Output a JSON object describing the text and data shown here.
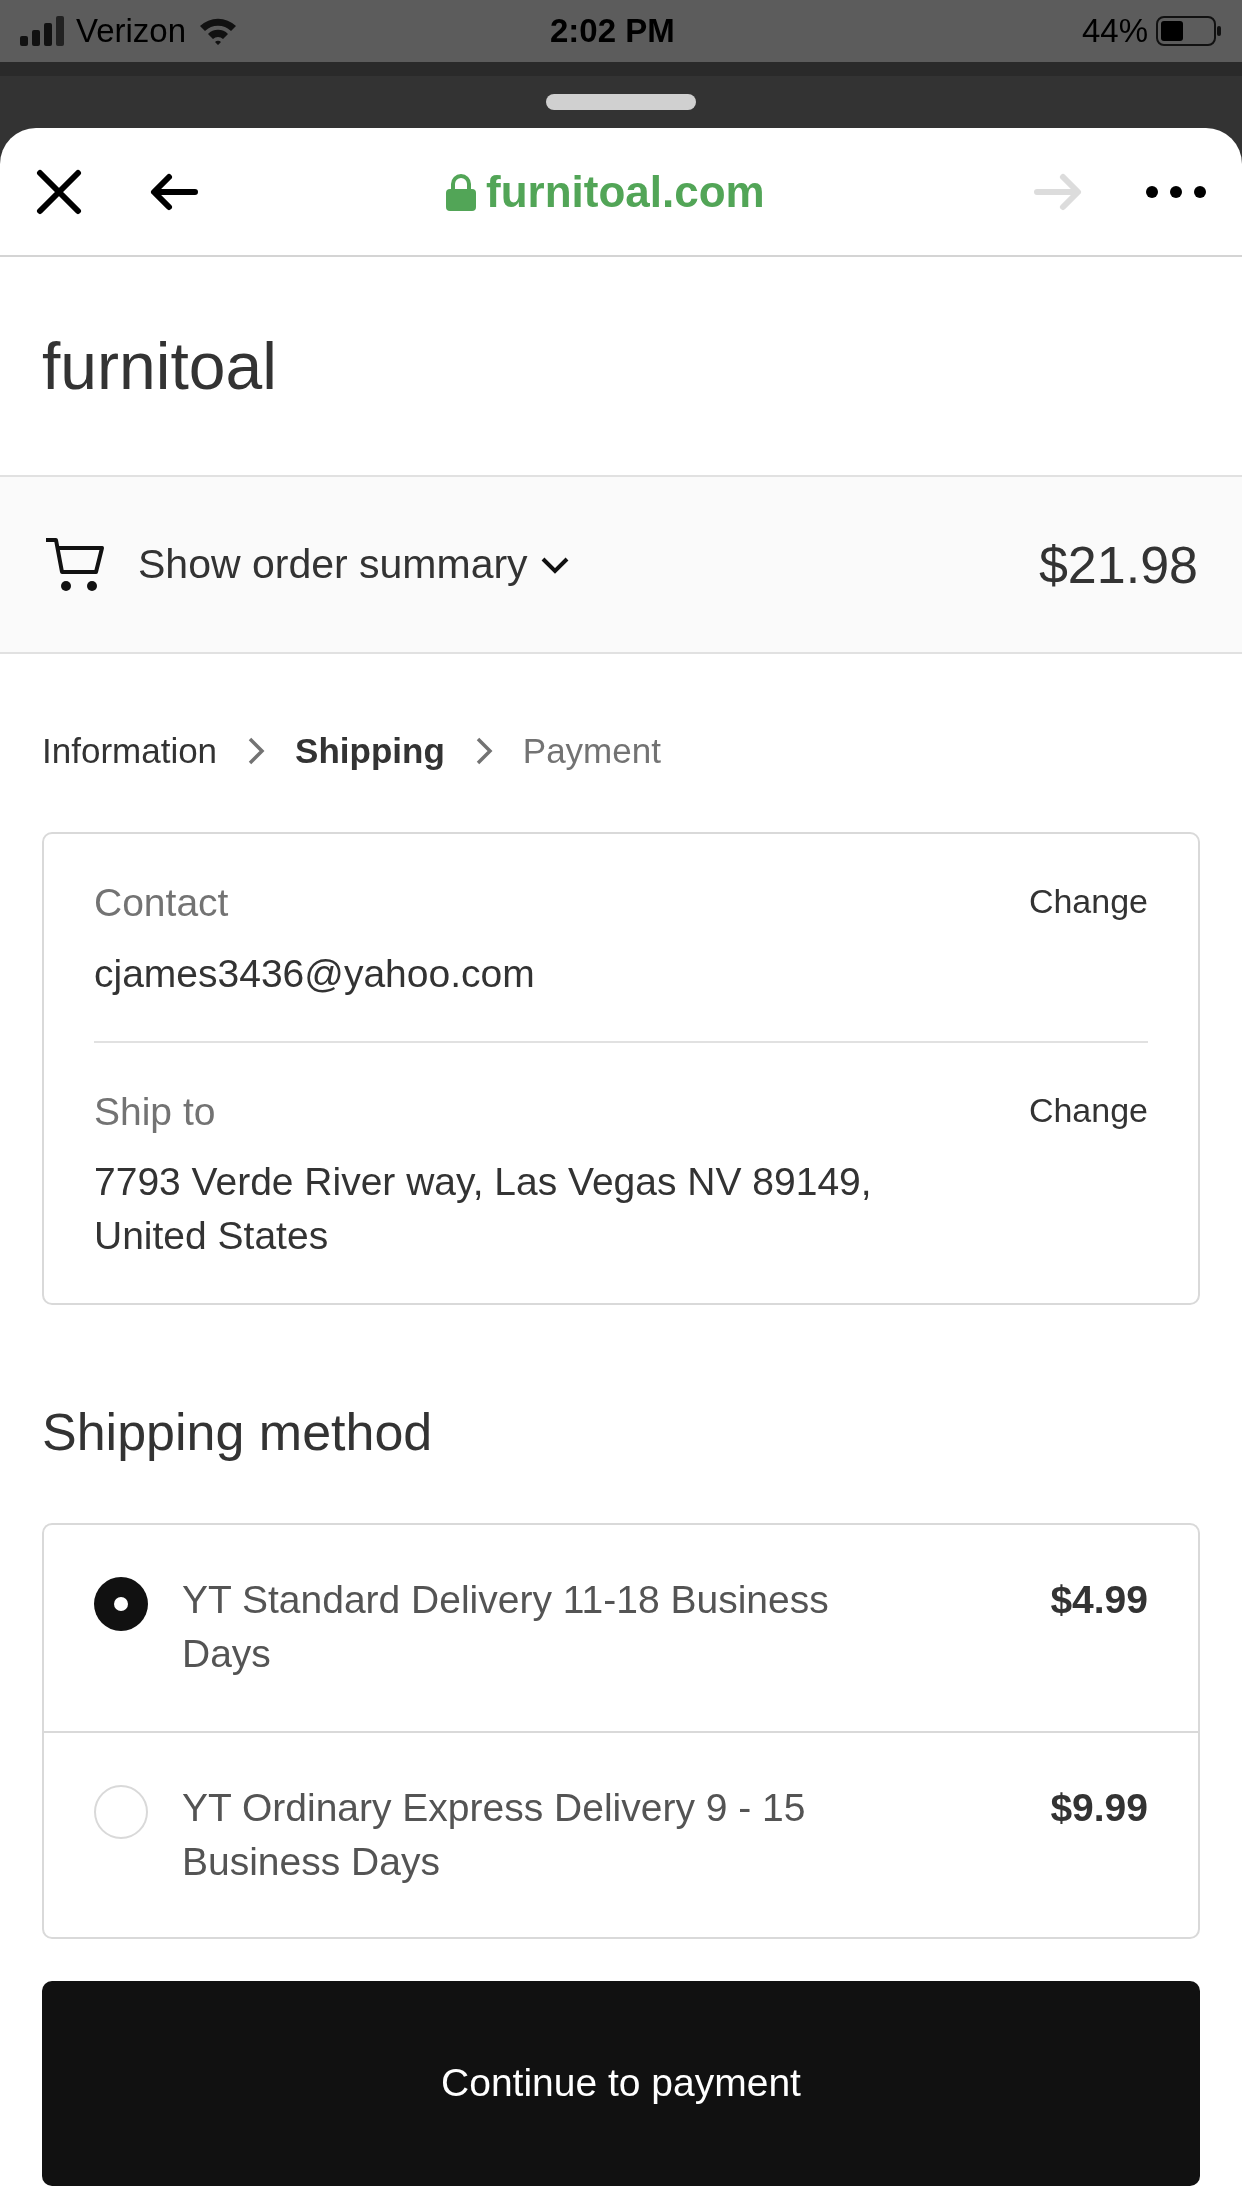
{
  "status_bar": {
    "carrier": "Verizon",
    "time": "2:02 PM",
    "battery": "44%"
  },
  "browser_bar": {
    "url": "furnitoal.com",
    "forward_disabled": true
  },
  "store_name": "furnitoal",
  "order_summary": {
    "label": "Show order summary",
    "expanded": false,
    "total": "$21.98"
  },
  "breadcrumb": [
    {
      "label": "Information",
      "selected": false,
      "disabled": false
    },
    {
      "label": "Shipping",
      "selected": true,
      "disabled": false
    },
    {
      "label": "Payment",
      "selected": false,
      "disabled": true
    }
  ],
  "review": [
    {
      "label": "Contact",
      "value": "cjames3436@yahoo.com",
      "action": "Change"
    },
    {
      "label": "Ship to",
      "value": "7793 Verde River way, Las Vegas NV 89149, United States",
      "action": "Change"
    }
  ],
  "shipping_method": {
    "title": "Shipping method",
    "options": [
      {
        "label": "YT Standard Delivery 11-18 Business Days",
        "price": "$4.99",
        "selected": true
      },
      {
        "label": "YT Ordinary Express Delivery 9 - 15 Business Days",
        "price": "$9.99",
        "selected": false
      }
    ]
  },
  "continue_button": "Continue to payment"
}
